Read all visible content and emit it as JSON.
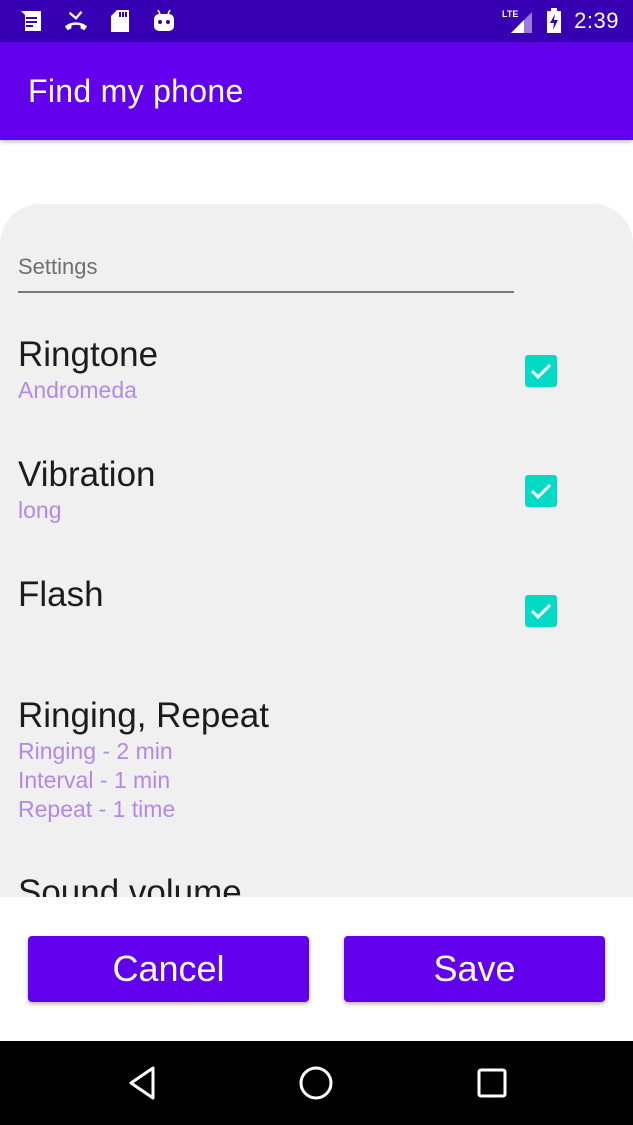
{
  "status_bar": {
    "left_icons": [
      "messages-icon",
      "missed-call-icon",
      "sd-card-icon",
      "android-debug-icon"
    ],
    "network": "LTE",
    "time": "2:39"
  },
  "app_bar": {
    "title": "Find my phone"
  },
  "settings": {
    "field_label": "Settings",
    "items": [
      {
        "title": "Ringtone",
        "summary": [
          "Andromeda"
        ],
        "checked": true
      },
      {
        "title": "Vibration",
        "summary": [
          "long"
        ],
        "checked": true
      },
      {
        "title": "Flash",
        "summary": [],
        "checked": true
      },
      {
        "title": "Ringing, Repeat",
        "summary": [
          "Ringing - 2 min",
          "Interval - 1 min",
          "Repeat - 1 time"
        ]
      },
      {
        "title": "Sound volume",
        "summary": []
      }
    ]
  },
  "actions": {
    "cancel_label": "Cancel",
    "save_label": "Save"
  },
  "colors": {
    "status_bar": "#3700B3",
    "primary": "#6200EE",
    "accent": "#03DAC5",
    "summary_text": "#B388EB",
    "card_bg": "#F0F0F0"
  }
}
